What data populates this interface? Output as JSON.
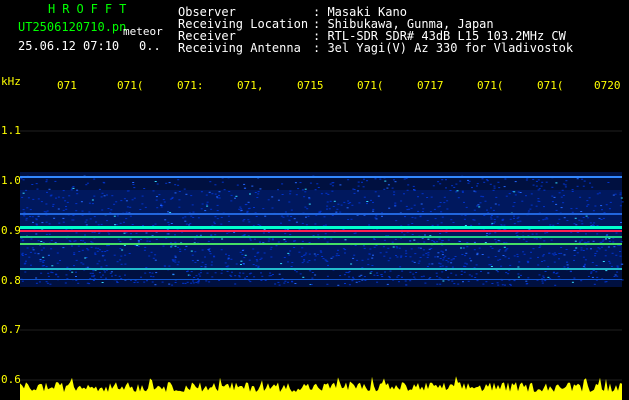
{
  "header": {
    "brand": "HROFFT",
    "filename": "UT2506120710.pn",
    "meteor_label": "meteor",
    "datetime": "25.06.12 07:10",
    "count": "0..",
    "info_labels": [
      "Observer",
      "Receiving Location",
      "Receiver",
      "Receiving Antenna"
    ],
    "info_values": [
      ": Masaki Kano",
      ": Shibukawa, Gunma, Japan",
      ": RTL-SDR SDR# 43dB L15 103.2MHz CW",
      ": 3el Yagi(V) Az 330 for Vladivostok"
    ]
  },
  "y_axis": {
    "unit": "kHz",
    "ticks": [
      "1.1",
      "1.0",
      "0.9",
      "0.8",
      "0.7",
      "0.6"
    ]
  },
  "x_axis": {
    "ticks": [
      "071",
      "071(",
      "071:",
      "071,",
      "0715",
      "071(",
      "0717",
      "071(",
      "071(",
      "0720"
    ]
  },
  "colors": {
    "background": "#000000",
    "text_green": "#00ff00",
    "text_white": "#ffffff",
    "text_yellow": "#ffff00",
    "band_blue": "#0033cc",
    "band_cyan": "#00ffcc",
    "band_red": "#ff2050"
  }
}
